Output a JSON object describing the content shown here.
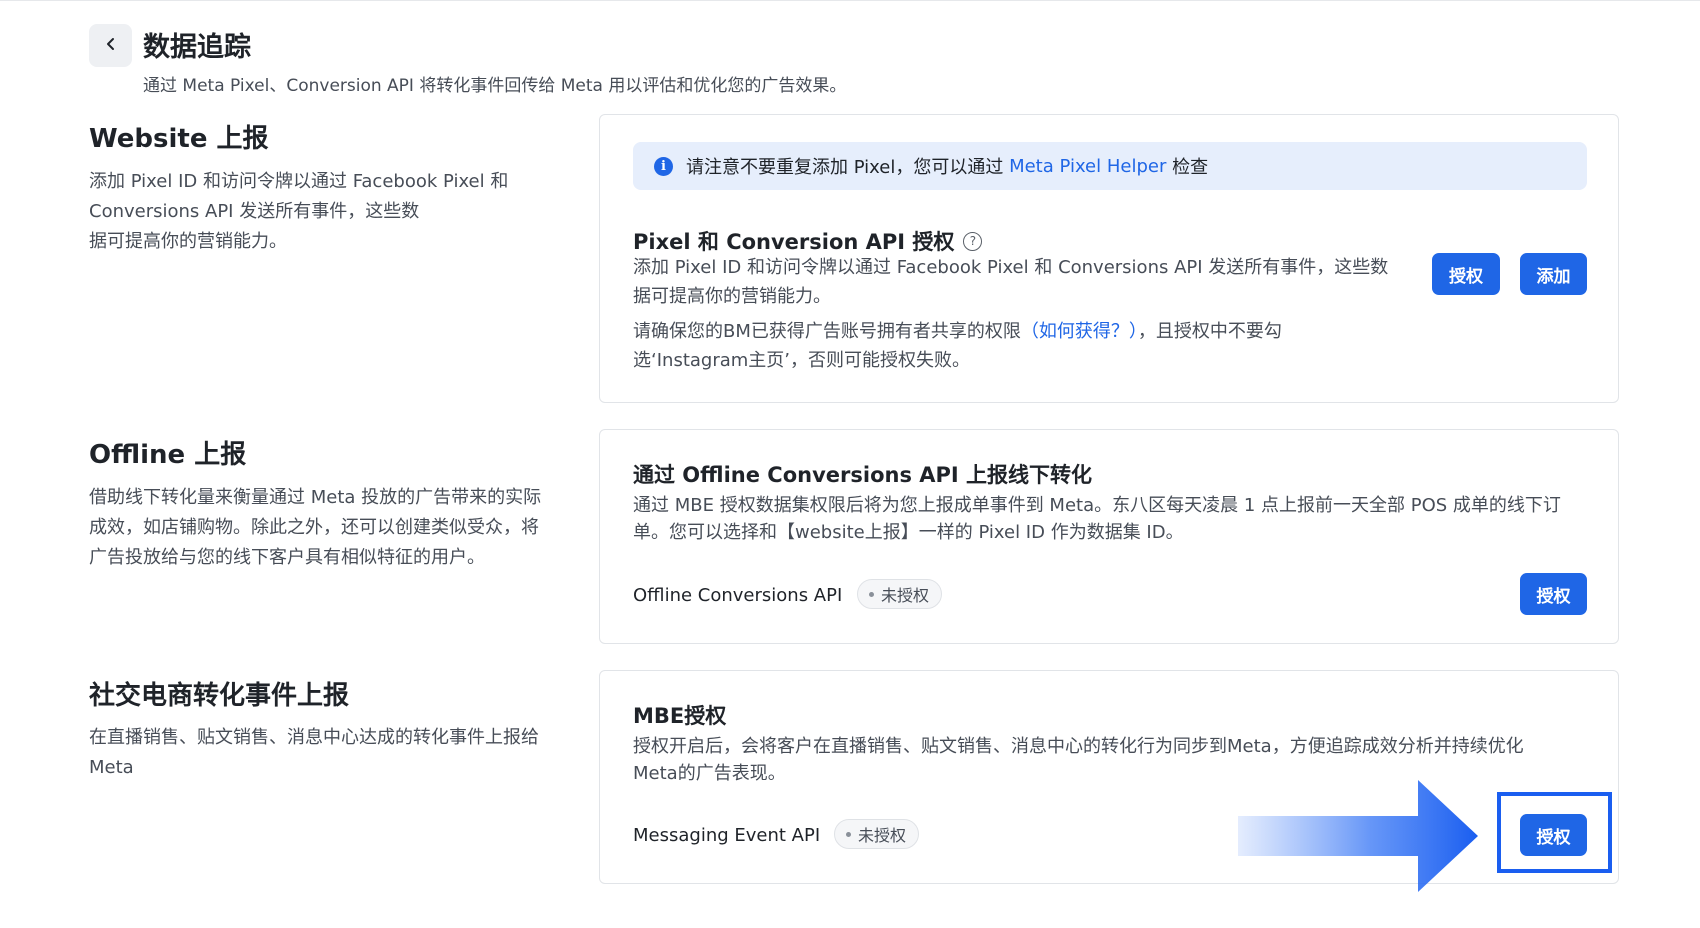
{
  "header": {
    "back_icon": "chevron-left-icon",
    "title": "数据追踪",
    "subtitle": "通过 Meta Pixel、Conversion API 将转化事件回传给 Meta 用以评估和优化您的广告效果。"
  },
  "website": {
    "title": "Website 上报",
    "desc_lines": [
      "添加 Pixel ID 和访问令牌以通过 Facebook Pixel 和 Conversions API 发送所有事件，这些数",
      "据可提高你的营销能力。"
    ],
    "notice": {
      "icon": "info-icon",
      "text": "请注意不要重复添加 Pixel，您可以通过 ",
      "link": "Meta Pixel Helper",
      "suffix": " 检查"
    },
    "card_title": "Pixel 和 Conversion API 授权",
    "help_icon": "question-circle-icon",
    "note_prefix": "请确保您的BM已获得广告账号拥有者共享的权限",
    "note_link": "（如何获得？）",
    "note_suffix": "，且授权中不要勾",
    "note_line2": "选‘Instagram主页’，否则可能授权失败。",
    "authorize_label": "授权",
    "add_label": "添加"
  },
  "offline": {
    "title": "Offline 上报",
    "desc_lines": [
      "借助线下转化量来衡量通过 Meta 投放的广告带来的实际",
      "成效，如店铺购物。除此之外，还可以创建类似受众，将",
      "广告投放给与您的线下客户具有相似特征的用户。"
    ],
    "card_title": "通过 Offline Conversions API 上报线下转化",
    "card_desc_lines": [
      "通过 MBE 授权数据集权限后将为您上报成单事件到 Meta。东八区每天凌晨 1 点上报前一天全部 POS 成单的线下订",
      "单。您可以选择和【website上报】一样的 Pixel ID 作为数据集 ID。"
    ],
    "api_name": "Offline Conversions API",
    "status": "未授权",
    "authorize_label": "授权"
  },
  "social": {
    "title": "社交电商转化事件上报",
    "desc_lines": [
      "在直播销售、贴文销售、消息中心达成的转化事件上报给",
      "Meta"
    ],
    "card_title": "MBE授权",
    "card_desc_lines": [
      "授权开启后，会将客户在直播销售、贴文销售、消息中心的转化行为同步到Meta，方便追踪成效分析并持续优化",
      "Meta的广告表现。"
    ],
    "api_name": "Messaging Event API",
    "status": "未授权",
    "authorize_label": "授权",
    "arrow_icon": "arrow-right-icon"
  },
  "colors": {
    "primary": "#1f66e6",
    "notice_bg": "#e6eefc",
    "highlight": "#1a5ef0"
  }
}
